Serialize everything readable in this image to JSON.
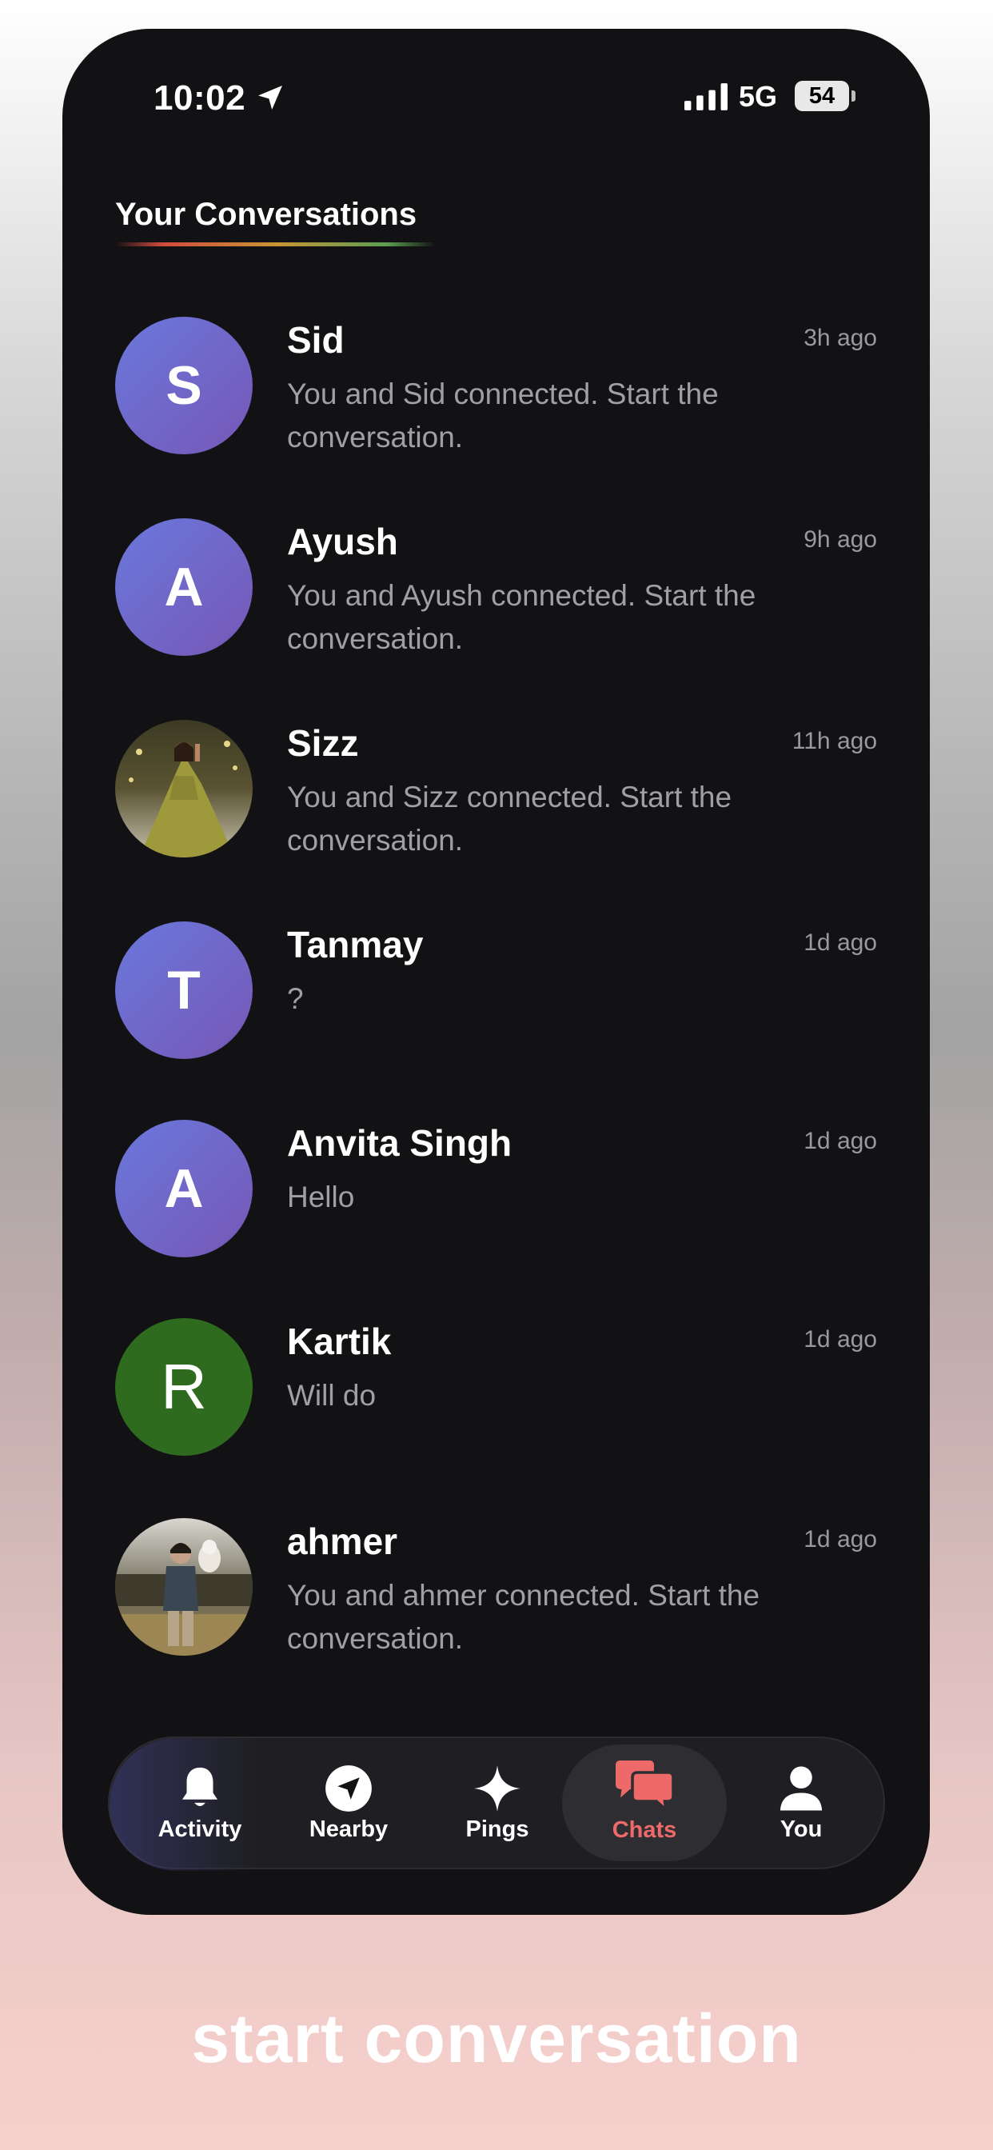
{
  "status_bar": {
    "time": "10:02",
    "network": "5G",
    "battery": "54"
  },
  "header": {
    "title": "Your Conversations"
  },
  "conversations": [
    {
      "initial": "S",
      "avatar_style": "purple",
      "name": "Sid",
      "time": "3h ago",
      "preview": "You and Sid connected. Start the conversation."
    },
    {
      "initial": "A",
      "avatar_style": "purple",
      "name": "Ayush",
      "time": "9h ago",
      "preview": "You and Ayush connected. Start the conversation."
    },
    {
      "initial": "",
      "avatar_style": "photo-woman",
      "name": "Sizz",
      "time": "11h ago",
      "preview": "You and Sizz connected. Start the conversation."
    },
    {
      "initial": "T",
      "avatar_style": "purple",
      "name": "Tanmay",
      "time": "1d ago",
      "preview": "?"
    },
    {
      "initial": "A",
      "avatar_style": "purple",
      "name": "Anvita Singh",
      "time": "1d ago",
      "preview": "Hello"
    },
    {
      "initial": "R",
      "avatar_style": "green",
      "name": "Kartik",
      "time": "1d ago",
      "preview": "Will do"
    },
    {
      "initial": "",
      "avatar_style": "photo-man",
      "name": "ahmer",
      "time": "1d ago",
      "preview": "You and ahmer connected. Start the conversation."
    }
  ],
  "tab_bar": {
    "active": "Chats",
    "active_color": "#ee6a6a",
    "tabs": [
      {
        "label": "Activity",
        "icon": "bell-icon"
      },
      {
        "label": "Nearby",
        "icon": "navigation-icon"
      },
      {
        "label": "Pings",
        "icon": "sparkle-icon"
      },
      {
        "label": "Chats",
        "icon": "chat-bubbles-icon"
      },
      {
        "label": "You",
        "icon": "person-icon"
      }
    ]
  },
  "caption": "start conversation"
}
